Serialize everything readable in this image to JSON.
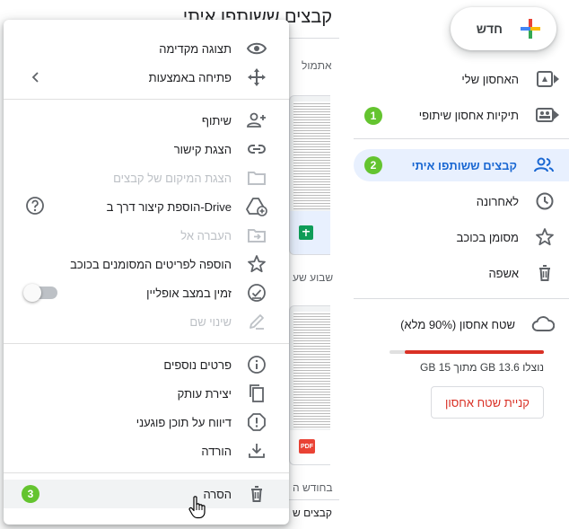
{
  "main": {
    "title": "קבצים ששותפו איתי",
    "yesterday_label": "אתמול",
    "last_week_label": "שבוע שע",
    "last_month_label": "בחודש ה",
    "shared_files_label": "קבצים ש",
    "pdf_badge": "PDF"
  },
  "sidebar": {
    "new_label": "חדש",
    "items": [
      {
        "label": "האחסון שלי",
        "icon": "drive-icon"
      },
      {
        "label": "תיקיות אחסון שיתופי",
        "icon": "shared-drives-icon"
      },
      {
        "label": "קבצים ששותפו איתי",
        "icon": "people-icon"
      },
      {
        "label": "לאחרונה",
        "icon": "clock-icon"
      },
      {
        "label": "מסומן בכוכב",
        "icon": "star-icon"
      },
      {
        "label": "אשפה",
        "icon": "trash-icon"
      }
    ],
    "storage": {
      "title": "שטח אחסון (90% מלא)",
      "used_text": "נוצלו 13.6 GB מתוך 15 GB",
      "percent": 90,
      "buy_label": "קניית שטח אחסון"
    }
  },
  "badges": [
    "1",
    "2",
    "3"
  ],
  "menu": {
    "sections": [
      [
        {
          "label": "תצוגה מקדימה",
          "icon": "eye-icon"
        },
        {
          "label": "פתיחה באמצעות",
          "icon": "move-icon",
          "left": "chevron-left-icon"
        }
      ],
      [
        {
          "label": "שיתוף",
          "icon": "person-add-icon"
        },
        {
          "label": "הצגת קישור",
          "icon": "link-icon"
        },
        {
          "label": "הצגת המיקום של קבצים",
          "icon": "folder-icon",
          "disabled": true
        },
        {
          "label": "הוספת קיצור דרך ב-Drive",
          "icon": "add-to-drive-icon",
          "left": "help-icon"
        },
        {
          "label": "העברה אל",
          "icon": "move-to-folder-icon",
          "disabled": true
        },
        {
          "label": "הוספה לפריטים המסומנים בכוכב",
          "icon": "star-outline-icon"
        },
        {
          "label": "זמין במצב אופליין",
          "icon": "offline-check-icon",
          "left": "toggle"
        },
        {
          "label": "שינוי שם",
          "icon": "pencil-icon",
          "disabled": true
        }
      ],
      [
        {
          "label": "פרטים נוספים",
          "icon": "info-icon"
        },
        {
          "label": "יצירת עותק",
          "icon": "copy-icon"
        },
        {
          "label": "דיווח על תוכן פוגעני",
          "icon": "report-icon"
        },
        {
          "label": "הורדה",
          "icon": "download-icon"
        }
      ],
      [
        {
          "label": "הסרה",
          "icon": "trash-icon",
          "hover": true
        }
      ]
    ]
  }
}
